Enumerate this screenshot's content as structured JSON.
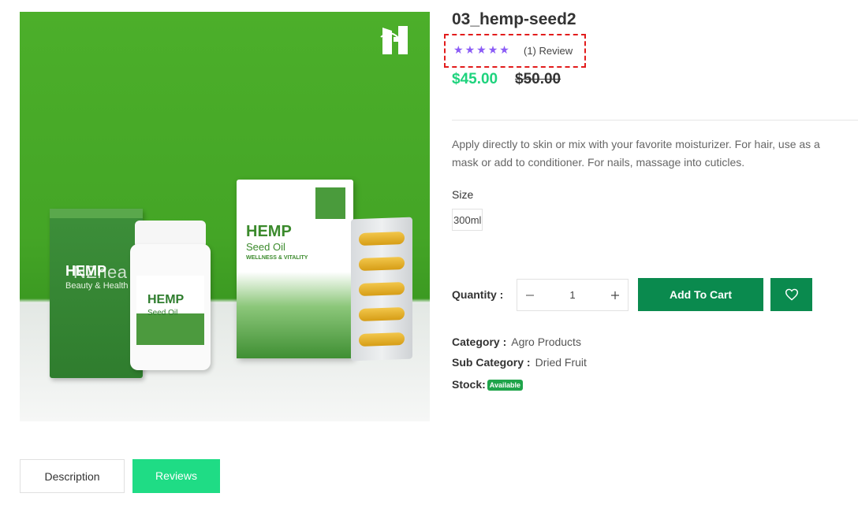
{
  "product": {
    "title": "03_hemp-seed2",
    "rating_stars": 5,
    "review_count": "(1) Review",
    "price_current": "$45.00",
    "price_old": "$50.00",
    "description": "Apply directly to skin or mix with your favorite moisturizer. For hair, use as a mask or add to conditioner. For nails, massage into cuticles.",
    "size_label": "Size",
    "size_value": "300ml",
    "quantity_label": "Quantity :",
    "quantity_value": "1",
    "add_to_cart": "Add To Cart",
    "category_label": "Category :",
    "category_value": "Agro Products",
    "subcategory_label": "Sub Category :",
    "subcategory_value": "Dried Fruit",
    "stock_label": "Stock:",
    "stock_value": "Available"
  },
  "image": {
    "watermark": "NZhea",
    "box_left_title": "HEMP",
    "box_left_sub": "Beauty & Health Ce",
    "bottle_title": "HEMP",
    "bottle_sub": "Seed Oil",
    "box_right_title": "HEMP",
    "box_right_sub": "Seed Oil",
    "box_right_tag": "WELLNESS & VITALITY"
  },
  "tabs": {
    "description": "Description",
    "reviews": "Reviews"
  },
  "colors": {
    "accent_green": "#1ed37d",
    "button_green": "#0a8a4e",
    "star_purple": "#8b5cf6",
    "highlight_red": "#e21c1c"
  },
  "icons": {
    "minus": "minus-icon",
    "plus": "plus-icon",
    "wishlist": "heart-icon",
    "star": "star-icon"
  }
}
